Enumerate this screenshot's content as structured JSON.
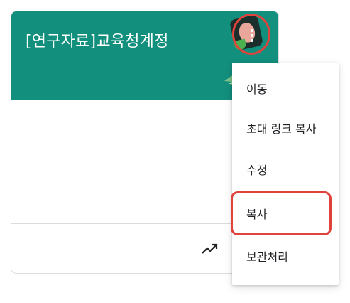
{
  "card": {
    "title": "[연구자료]교육청계정"
  },
  "menu": {
    "items": [
      {
        "label": "이동"
      },
      {
        "label": "초대 링크 복사"
      },
      {
        "label": "수정"
      },
      {
        "label": "복사"
      },
      {
        "label": "보관처리"
      }
    ]
  },
  "icons": {
    "more": "more-vert-icon",
    "trend": "trending-up-icon"
  },
  "colors": {
    "header": "#138f7d",
    "highlight": "#e0433b"
  }
}
